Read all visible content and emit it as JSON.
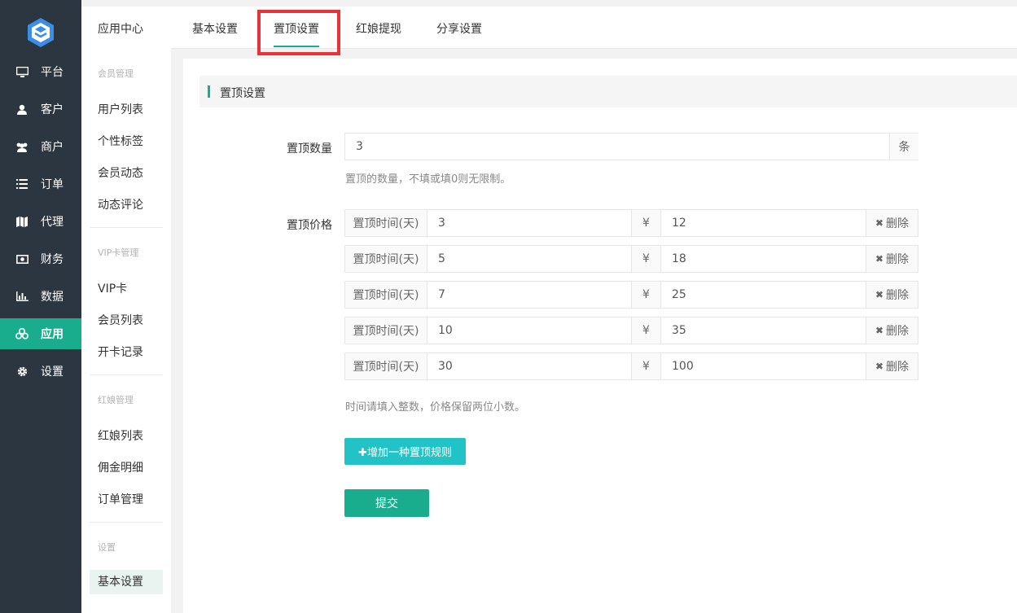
{
  "colors": {
    "nav_bg": "#2b3640",
    "accent": "#1aad8d",
    "add_button": "#22c3c6",
    "highlight_box": "#e8333a"
  },
  "nav": {
    "items": [
      {
        "label": "平台",
        "icon": "monitor-icon"
      },
      {
        "label": "客户",
        "icon": "user-icon"
      },
      {
        "label": "商户",
        "icon": "users-icon"
      },
      {
        "label": "订单",
        "icon": "list-icon"
      },
      {
        "label": "代理",
        "icon": "map-icon"
      },
      {
        "label": "财务",
        "icon": "money-icon"
      },
      {
        "label": "数据",
        "icon": "bar-chart-icon"
      },
      {
        "label": "应用",
        "icon": "apps-icon",
        "active": true
      },
      {
        "label": "设置",
        "icon": "gear-icon"
      }
    ]
  },
  "sidebar": {
    "title": "应用中心",
    "groups": [
      {
        "name": "会员管理",
        "items": [
          "用户列表",
          "个性标签",
          "会员动态",
          "动态评论"
        ]
      },
      {
        "name": "VIP卡管理",
        "items": [
          "VIP卡",
          "会员列表",
          "开卡记录"
        ]
      },
      {
        "name": "红娘管理",
        "items": [
          "红娘列表",
          "佣金明细",
          "订单管理"
        ]
      },
      {
        "name": "设置",
        "items": [
          "基本设置"
        ]
      }
    ]
  },
  "tabs": [
    "基本设置",
    "置顶设置",
    "红娘提现",
    "分享设置"
  ],
  "active_tab": "置顶设置",
  "section_title": "置顶设置",
  "form": {
    "count_label": "置顶数量",
    "count_value": "3",
    "count_unit": "条",
    "count_hint": "置顶的数量，不填或填0则无限制。",
    "price_label": "置顶价格",
    "time_addon": "置顶时间(天)",
    "currency": "¥",
    "delete_label": "删除",
    "rules": [
      {
        "days": "3",
        "price": "12"
      },
      {
        "days": "5",
        "price": "18"
      },
      {
        "days": "7",
        "price": "25"
      },
      {
        "days": "10",
        "price": "35"
      },
      {
        "days": "30",
        "price": "100"
      }
    ],
    "rules_hint": "时间请填入整数，价格保留两位小数。",
    "add_button": "✚增加一种置顶规则",
    "submit_button": "提交"
  }
}
